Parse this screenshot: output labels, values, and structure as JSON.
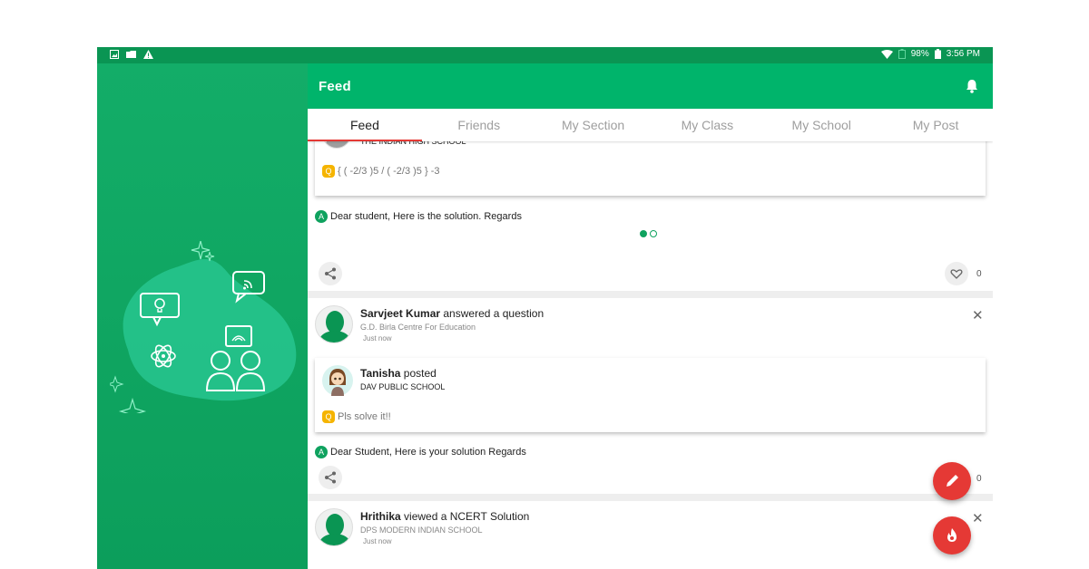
{
  "status_bar": {
    "battery": "98%",
    "time": "3:56 PM"
  },
  "appbar": {
    "title": "Feed"
  },
  "tabs": [
    {
      "label": "Feed",
      "active": true
    },
    {
      "label": "Friends"
    },
    {
      "label": "My Section"
    },
    {
      "label": "My Class"
    },
    {
      "label": "My School"
    },
    {
      "label": "My Post"
    }
  ],
  "posts": [
    {
      "inner_school": "THE INDIAN HIGH SCHOOL",
      "question": "{ ( -2/3 )5 / ( -2/3 )5 } -3",
      "answer": "Dear student, Here is the solution. Regards",
      "likes": "0"
    },
    {
      "user": "Sarvjeet Kumar",
      "action": " answered a question",
      "school": "G.D. Birla Centre For Education",
      "time": "Just now",
      "inner_user": "Tanisha",
      "inner_action": " posted",
      "inner_school": "DAV PUBLIC SCHOOL",
      "question": "Pls solve it!!",
      "answer": "Dear Student, Here is your solution Regards",
      "likes": "0"
    },
    {
      "user": "Hrithika",
      "action": " viewed a NCERT Solution",
      "school": "DPS MODERN INDIAN SCHOOL",
      "time": "Just now"
    }
  ],
  "badges": {
    "question": "Q",
    "answer": "A"
  },
  "colors": {
    "primary": "#00b46b",
    "sidebar": "#0fa25f",
    "accent": "#e53935",
    "question_badge": "#f5b400"
  },
  "icons": [
    "bell-icon",
    "share-icon",
    "heart-icon",
    "close-icon",
    "pencil-icon",
    "fire-icon"
  ]
}
